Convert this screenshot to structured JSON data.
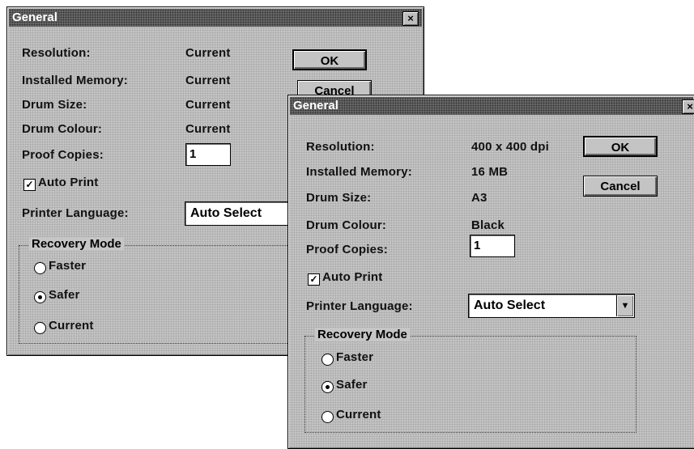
{
  "back_dialog": {
    "title": "General",
    "close_glyph": "×",
    "labels": {
      "resolution": "Resolution:",
      "memory": "Installed Memory:",
      "drum_size": "Drum Size:",
      "drum_colour": "Drum Colour:",
      "proof_copies": "Proof Copies:",
      "auto_print": "Auto Print",
      "printer_language": "Printer Language:"
    },
    "values": {
      "resolution": "Current",
      "memory": "Current",
      "drum_size": "Current",
      "drum_colour": "Current"
    },
    "proof_copies_value": "1",
    "auto_print_checked": true,
    "check_glyph": "✓",
    "printer_language_value": "Auto Select",
    "buttons": {
      "ok": "OK",
      "cancel": "Cancel"
    },
    "recovery": {
      "title": "Recovery Mode",
      "options": [
        "Faster",
        "Safer",
        "Current"
      ],
      "selected": "Safer"
    }
  },
  "front_dialog": {
    "title": "General",
    "close_glyph": "×",
    "labels": {
      "resolution": "Resolution:",
      "memory": "Installed Memory:",
      "drum_size": "Drum Size:",
      "drum_colour": "Drum Colour:",
      "proof_copies": "Proof Copies:",
      "auto_print": "Auto Print",
      "printer_language": "Printer Language:"
    },
    "values": {
      "resolution": "400 x 400 dpi",
      "memory": "16 MB",
      "drum_size": "A3",
      "drum_colour": "Black"
    },
    "proof_copies_value": "1",
    "auto_print_checked": true,
    "check_glyph": "✓",
    "printer_language_value": "Auto Select",
    "dropdown_glyph": "▼",
    "buttons": {
      "ok": "OK",
      "cancel": "Cancel"
    },
    "recovery": {
      "title": "Recovery Mode",
      "options": [
        "Faster",
        "Safer",
        "Current"
      ],
      "selected": "Safer"
    }
  }
}
